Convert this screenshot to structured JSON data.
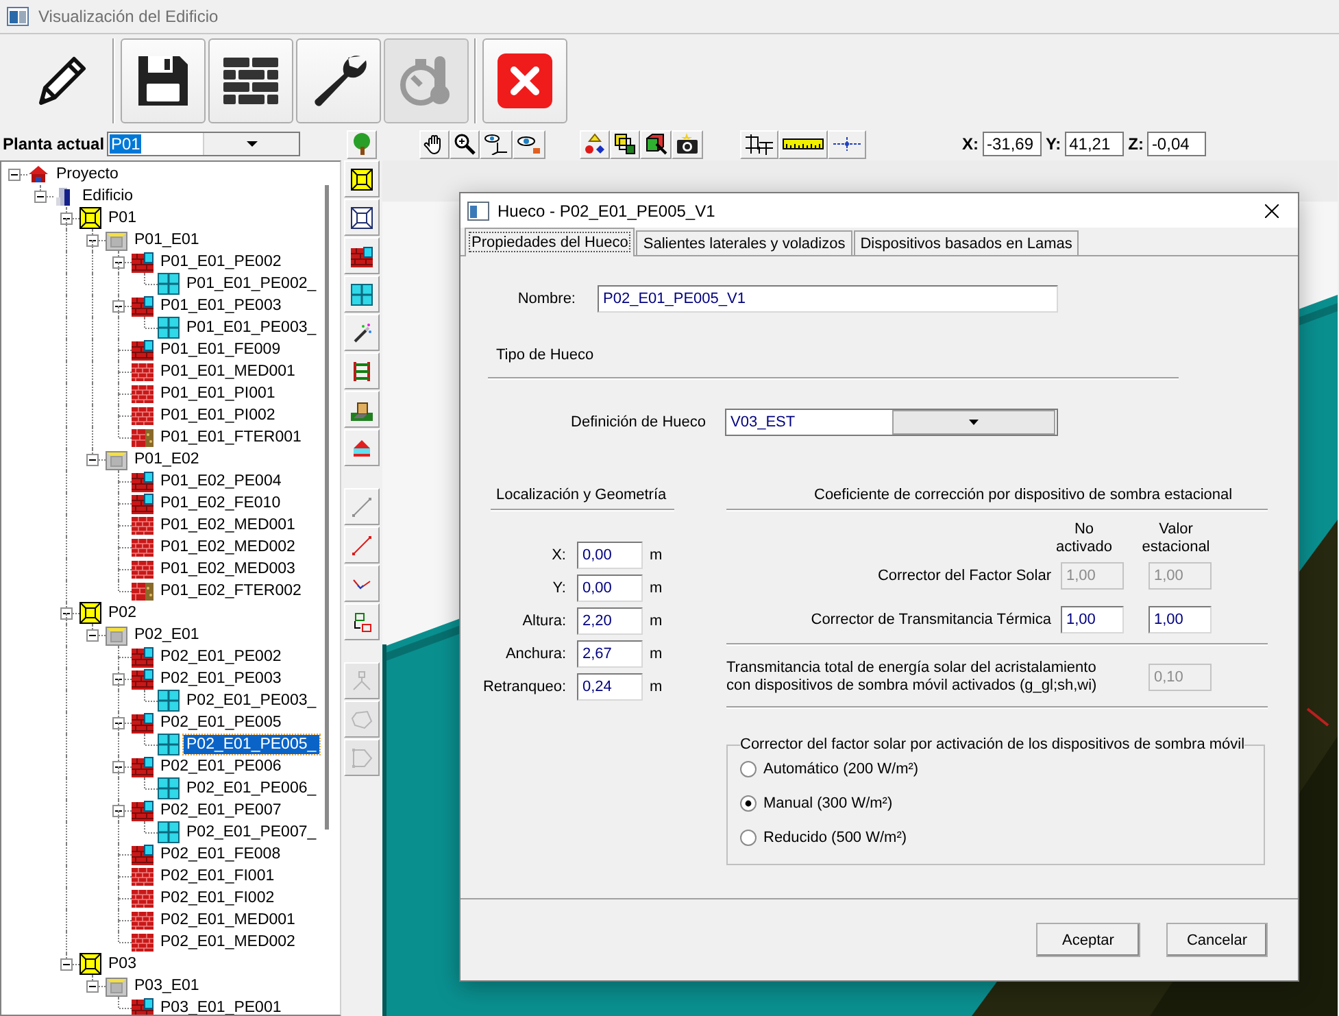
{
  "window": {
    "title": "Visualización del Edificio"
  },
  "main_toolbar": {
    "groups": [
      {
        "buttons": [
          {
            "kind": "edit",
            "disabled": false
          }
        ]
      },
      {
        "buttons": [
          {
            "kind": "save",
            "disabled": false
          },
          {
            "kind": "walls",
            "disabled": false
          },
          {
            "kind": "tools",
            "disabled": false
          },
          {
            "kind": "climate",
            "disabled": true
          }
        ]
      },
      {
        "buttons": [
          {
            "kind": "close",
            "disabled": false
          }
        ]
      }
    ]
  },
  "plant_bar": {
    "label": "Planta actual",
    "value": "P01"
  },
  "coordinates": [
    {
      "label": "X:",
      "value": "-31,69"
    },
    {
      "label": "Y:",
      "value": "41,21"
    },
    {
      "label": "Z:",
      "value": "-0,04"
    }
  ],
  "tree": [
    {
      "label": "Proyecto",
      "kind": "project",
      "expanded": true,
      "selected": false,
      "children": [
        {
          "label": "Edificio",
          "kind": "building",
          "expanded": true,
          "selected": false,
          "children": [
            {
              "label": "P01",
              "kind": "floor",
              "expanded": true,
              "selected": false,
              "children": [
                {
                  "label": "P01_E01",
                  "kind": "room",
                  "expanded": true,
                  "selected": false,
                  "children": [
                    {
                      "label": "P01_E01_PE002",
                      "kind": "wall_window",
                      "expanded": true,
                      "selected": false,
                      "children": [
                        {
                          "label": "P01_E01_PE002_",
                          "kind": "window",
                          "selected": false
                        }
                      ]
                    },
                    {
                      "label": "P01_E01_PE003",
                      "kind": "wall_window",
                      "expanded": true,
                      "selected": false,
                      "children": [
                        {
                          "label": "P01_E01_PE003_",
                          "kind": "window",
                          "selected": false
                        }
                      ]
                    },
                    {
                      "label": "P01_E01_FE009",
                      "kind": "wall_window",
                      "selected": false
                    },
                    {
                      "label": "P01_E01_MED001",
                      "kind": "wall",
                      "selected": false
                    },
                    {
                      "label": "P01_E01_PI001",
                      "kind": "wall",
                      "selected": false
                    },
                    {
                      "label": "P01_E01_PI002",
                      "kind": "wall",
                      "selected": false
                    },
                    {
                      "label": "P01_E01_FTER001",
                      "kind": "ground",
                      "selected": false
                    }
                  ]
                },
                {
                  "label": "P01_E02",
                  "kind": "room",
                  "expanded": true,
                  "selected": false,
                  "children": [
                    {
                      "label": "P01_E02_PE004",
                      "kind": "wall_window",
                      "selected": false
                    },
                    {
                      "label": "P01_E02_FE010",
                      "kind": "wall_window",
                      "selected": false
                    },
                    {
                      "label": "P01_E02_MED001",
                      "kind": "wall",
                      "selected": false
                    },
                    {
                      "label": "P01_E02_MED002",
                      "kind": "wall",
                      "selected": false
                    },
                    {
                      "label": "P01_E02_MED003",
                      "kind": "wall",
                      "selected": false
                    },
                    {
                      "label": "P01_E02_FTER002",
                      "kind": "ground",
                      "selected": false
                    }
                  ]
                }
              ]
            },
            {
              "label": "P02",
              "kind": "floor",
              "expanded": true,
              "selected": false,
              "children": [
                {
                  "label": "P02_E01",
                  "kind": "room",
                  "expanded": true,
                  "selected": false,
                  "children": [
                    {
                      "label": "P02_E01_PE002",
                      "kind": "wall_window",
                      "selected": false
                    },
                    {
                      "label": "P02_E01_PE003",
                      "kind": "wall_window",
                      "expanded": true,
                      "selected": false,
                      "children": [
                        {
                          "label": "P02_E01_PE003_",
                          "kind": "window",
                          "selected": false
                        }
                      ]
                    },
                    {
                      "label": "P02_E01_PE005",
                      "kind": "wall_window",
                      "expanded": true,
                      "selected": false,
                      "children": [
                        {
                          "label": "P02_E01_PE005_",
                          "kind": "window",
                          "selected": true
                        }
                      ]
                    },
                    {
                      "label": "P02_E01_PE006",
                      "kind": "wall_window",
                      "expanded": true,
                      "selected": false,
                      "children": [
                        {
                          "label": "P02_E01_PE006_",
                          "kind": "window",
                          "selected": false
                        }
                      ]
                    },
                    {
                      "label": "P02_E01_PE007",
                      "kind": "wall_window",
                      "expanded": true,
                      "selected": false,
                      "children": [
                        {
                          "label": "P02_E01_PE007_",
                          "kind": "window",
                          "selected": false
                        }
                      ]
                    },
                    {
                      "label": "P02_E01_FE008",
                      "kind": "wall_window",
                      "selected": false
                    },
                    {
                      "label": "P02_E01_FI001",
                      "kind": "wall",
                      "selected": false
                    },
                    {
                      "label": "P02_E01_FI002",
                      "kind": "wall",
                      "selected": false
                    },
                    {
                      "label": "P02_E01_MED001",
                      "kind": "wall",
                      "selected": false
                    },
                    {
                      "label": "P02_E01_MED002",
                      "kind": "wall",
                      "selected": false
                    }
                  ]
                }
              ]
            },
            {
              "label": "P03",
              "kind": "floor",
              "expanded": true,
              "selected": false,
              "children": [
                {
                  "label": "P03_E01",
                  "kind": "room",
                  "expanded": true,
                  "selected": false,
                  "children": [
                    {
                      "label": "P03_E01_PE001",
                      "kind": "wall_window",
                      "selected": false
                    }
                  ]
                }
              ]
            }
          ]
        }
      ]
    }
  ],
  "tool_column": {
    "groups": [
      {
        "buttons": [
          {
            "kind": "floor",
            "disabled": false
          },
          {
            "kind": "floor_outline",
            "disabled": false
          },
          {
            "kind": "wall_window",
            "disabled": false
          },
          {
            "kind": "window",
            "disabled": false
          },
          {
            "kind": "wand",
            "disabled": false
          },
          {
            "kind": "ladder",
            "disabled": false
          },
          {
            "kind": "step",
            "disabled": false
          },
          {
            "kind": "house",
            "disabled": false
          }
        ]
      },
      {
        "buttons": [
          {
            "kind": "line",
            "disabled": false
          },
          {
            "kind": "segment",
            "disabled": false
          },
          {
            "kind": "polyline",
            "disabled": false
          },
          {
            "kind": "copy",
            "disabled": false
          }
        ]
      },
      {
        "buttons": [
          {
            "kind": "node",
            "disabled": true
          },
          {
            "kind": "polygon",
            "disabled": true
          },
          {
            "kind": "polygon_arrow",
            "disabled": true
          }
        ]
      }
    ]
  },
  "dialog": {
    "title": "Hueco - P02_E01_PE005_V1",
    "tabs": [
      {
        "label": "Propiedades del Hueco",
        "selected": true
      },
      {
        "label": "Salientes laterales y voladizos",
        "selected": false
      },
      {
        "label": "Dispositivos basados en Lamas",
        "selected": false
      }
    ],
    "name_field": {
      "label": "Nombre:",
      "value": "P02_E01_PE005_V1"
    },
    "type_section": {
      "title": "Tipo de Hueco",
      "definition": {
        "label": "Definición de Hueco",
        "value": "V03_EST"
      }
    },
    "geometry": {
      "title": "Localización y Geometría",
      "fields": [
        {
          "label": "X:",
          "value": "0,00",
          "unit": "m"
        },
        {
          "label": "Y:",
          "value": "0,00",
          "unit": "m"
        },
        {
          "label": "Altura:",
          "value": "2,20",
          "unit": "m"
        },
        {
          "label": "Anchura:",
          "value": "2,67",
          "unit": "m"
        },
        {
          "label": "Retranqueo:",
          "value": "0,24",
          "unit": "m"
        }
      ]
    },
    "correction": {
      "title": "Coeficiente de corrección por dispositivo de sombra estacional",
      "columns": [
        "No\nactivado",
        "Valor\nestacional"
      ],
      "rows": [
        {
          "label": "Corrector del Factor Solar",
          "values": [
            {
              "value": "1,00",
              "disabled": true
            },
            {
              "value": "1,00",
              "disabled": true
            }
          ]
        },
        {
          "label": "Corrector de Transmitancia Térmica",
          "values": [
            {
              "value": "1,00",
              "disabled": false
            },
            {
              "value": "1,00",
              "disabled": false
            }
          ]
        }
      ]
    },
    "transmittance": {
      "label": "Transmitancia total de energía solar del acristalamiento\ncon dispositivos de sombra móvil activados (g_gl;sh,wi)",
      "value": "0,10",
      "disabled": true
    },
    "activation": {
      "title": "Corrector del factor solar por activación de los dispositivos de sombra móvil",
      "options": [
        {
          "label": "Automático (200 W/m²)",
          "selected": false
        },
        {
          "label": "Manual (300 W/m²)",
          "selected": true
        },
        {
          "label": "Reducido (500 W/m²)",
          "selected": false
        }
      ]
    },
    "buttons": [
      "Aceptar",
      "Cancelar"
    ]
  }
}
